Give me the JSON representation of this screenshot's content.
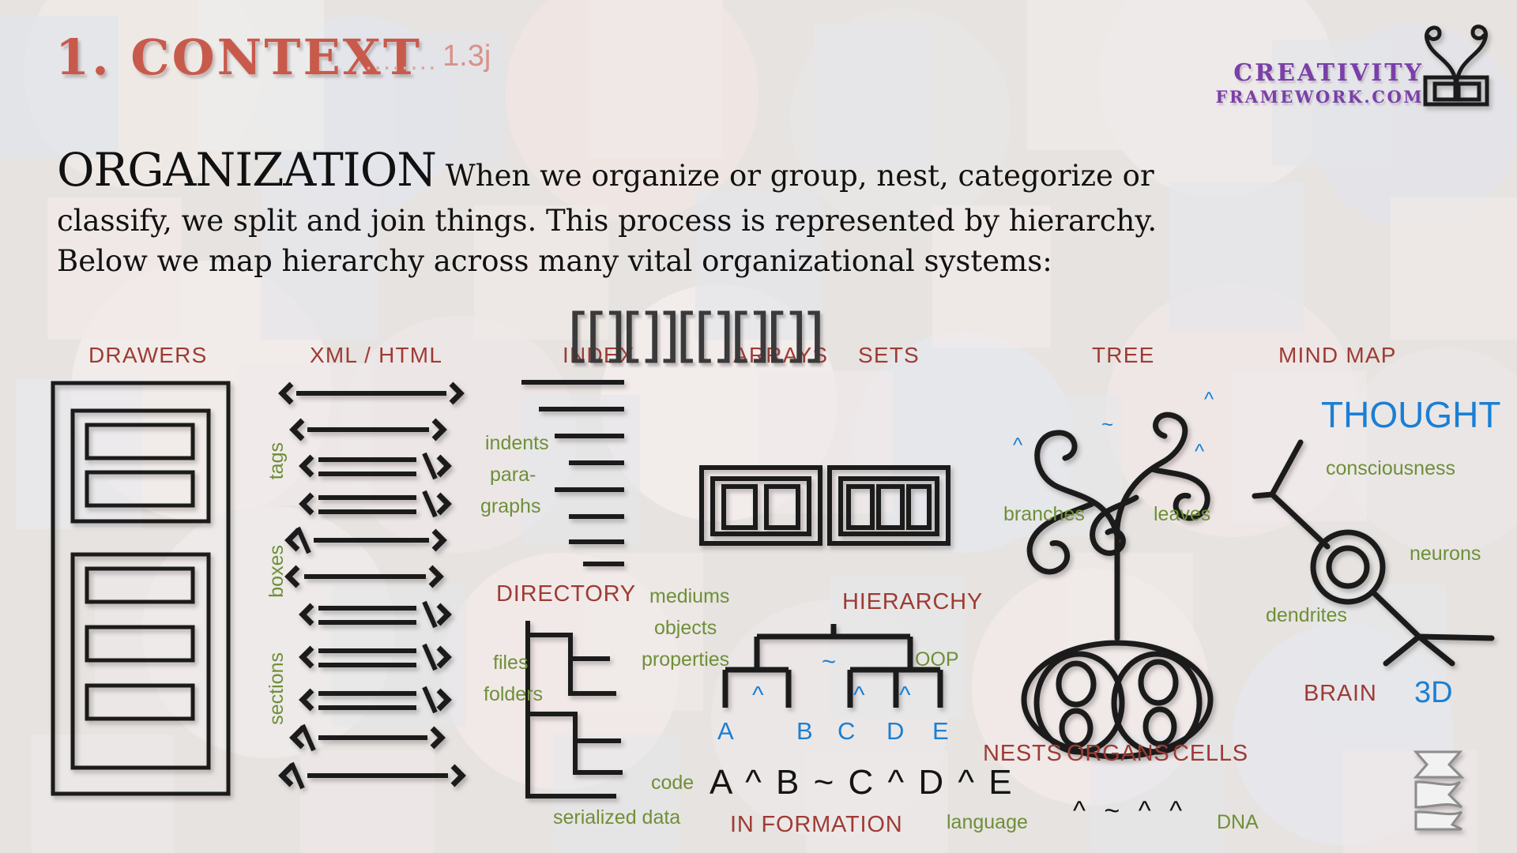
{
  "header": {
    "section_number_title": "1. CONTEXT",
    "dots": "........",
    "version": "1.3j",
    "logo_line1": "CREATIVITY",
    "logo_line2": "FRAMEWORK.COM",
    "logo_icon": "framed-box-with-antennae-icon"
  },
  "headline": {
    "keyword": "ORGANIZATION",
    "body": "When we organize or group, nest, categorize or classify, we split and join things.  This process is represented by hierarchy. Below we map hierarchy across many vital organizational systems:"
  },
  "columns": [
    {
      "id": "drawers",
      "label": "DRAWERS"
    },
    {
      "id": "xml",
      "label": "XML / HTML"
    },
    {
      "id": "index",
      "label": "INDEX"
    },
    {
      "id": "arrays",
      "label": "ARRAYS"
    },
    {
      "id": "sets",
      "label": "SETS"
    },
    {
      "id": "tree",
      "label": "TREE"
    },
    {
      "id": "mindmap",
      "label": "MIND MAP"
    }
  ],
  "xml_column": {
    "side_labels": [
      "tags",
      "boxes",
      "sections"
    ],
    "annotations": [
      "indents",
      "para-",
      "graphs"
    ],
    "rows": [
      {
        "type": "open-wide",
        "glyph": "<———>"
      },
      {
        "type": "open",
        "glyph": "<——>"
      },
      {
        "type": "self-close",
        "glyph": "<==/>"
      },
      {
        "type": "self-close",
        "glyph": "<==/>"
      },
      {
        "type": "close",
        "glyph": "</——>"
      },
      {
        "type": "open",
        "glyph": "<——>"
      },
      {
        "type": "self-close",
        "glyph": "<==/>"
      },
      {
        "type": "self-close",
        "glyph": "<==/>"
      },
      {
        "type": "self-close",
        "glyph": "<==/>"
      },
      {
        "type": "close",
        "glyph": "</——>"
      },
      {
        "type": "close-wide",
        "glyph": "</———>"
      }
    ]
  },
  "index_column": {
    "label": "INDEX",
    "rule_count": 8
  },
  "directory": {
    "label": "DIRECTORY",
    "labels": [
      "files",
      "folders",
      "code",
      "serialized data"
    ]
  },
  "arrays_column": {
    "brackets": "[[][]][[][][]]",
    "annotations": [
      "mediums",
      "objects",
      "properties"
    ]
  },
  "hierarchy": {
    "label": "HIERARCHY",
    "oop_label": "OOP",
    "in_formation_label": "IN FORMATION",
    "language_label": "language",
    "root_operator": "~",
    "node_operators": [
      "^",
      "^",
      "^"
    ],
    "leaves": [
      "A",
      "B",
      "C",
      "D",
      "E"
    ],
    "formula": "A ^ B ~ C ^ D ^ E"
  },
  "tree_column": {
    "labels": [
      "branches",
      "leaves"
    ],
    "operators": [
      "^",
      "~",
      "^",
      "^"
    ],
    "bottom_labels": [
      "NESTS",
      "ORGANS",
      "CELLS"
    ],
    "dna_label": "DNA",
    "dna_sequence": "^ ~ ^ ^"
  },
  "mindmap_column": {
    "thought": "THOUGHT",
    "labels": [
      "consciousness",
      "neurons",
      "dendrites"
    ],
    "brain_label": "BRAIN",
    "three_d_label": "3D"
  },
  "watermark": {
    "icon": "dm-monogram-icon"
  },
  "colors": {
    "title_red": "#c85a4c",
    "label_red": "#9e3b34",
    "green": "#6f8f38",
    "blue": "#1a7fd4",
    "purple": "#7a3fa8",
    "ink": "#1b1b1b",
    "page_bg": "#e6e3e0"
  }
}
